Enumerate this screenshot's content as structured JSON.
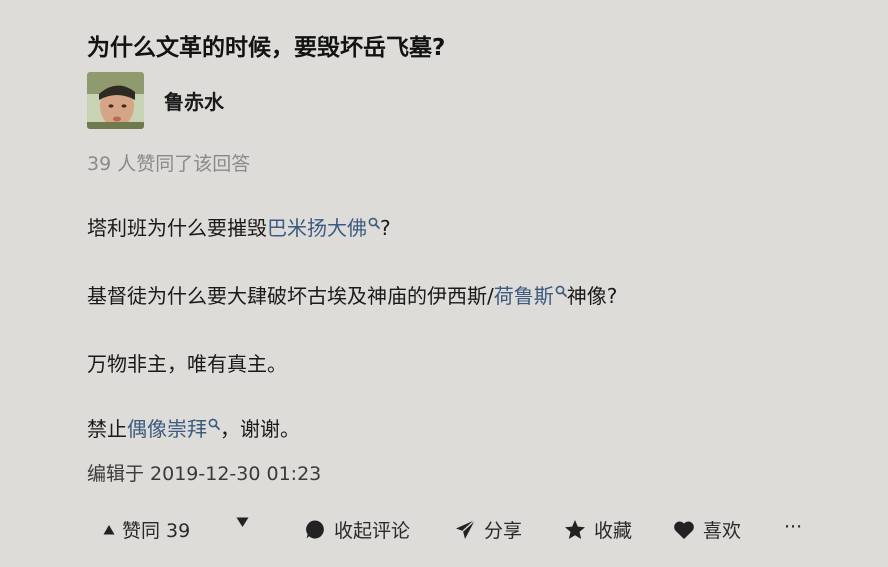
{
  "question": {
    "title": "为什么文革的时候，要毁坏岳飞墓?"
  },
  "author": {
    "name": "鲁赤水"
  },
  "voters_text": "39 人赞同了该回答",
  "content": {
    "p1": {
      "pre": "塔利班为什么要摧毁",
      "keyword": "巴米扬大佛",
      "post": "?"
    },
    "p2": {
      "pre": "基督徒为什么要大肆破坏古埃及神庙的伊西斯/",
      "keyword": "荷鲁斯",
      "post": "神像?"
    },
    "p3": {
      "text": "万物非主，唯有真主。"
    },
    "p4": {
      "pre": "禁止",
      "keyword": "偶像崇拜",
      "post": "，谢谢。"
    }
  },
  "edit_time": "编辑于 2019-12-30 01:23",
  "actions": {
    "vote_up": "赞同 39",
    "comment": "收起评论",
    "share": "分享",
    "favorite": "收藏",
    "like": "喜欢",
    "more": "···"
  },
  "colors": {
    "background": "#dedcd9",
    "keyword_link": "#3d5a80",
    "muted_text": "#8a8a8a"
  }
}
